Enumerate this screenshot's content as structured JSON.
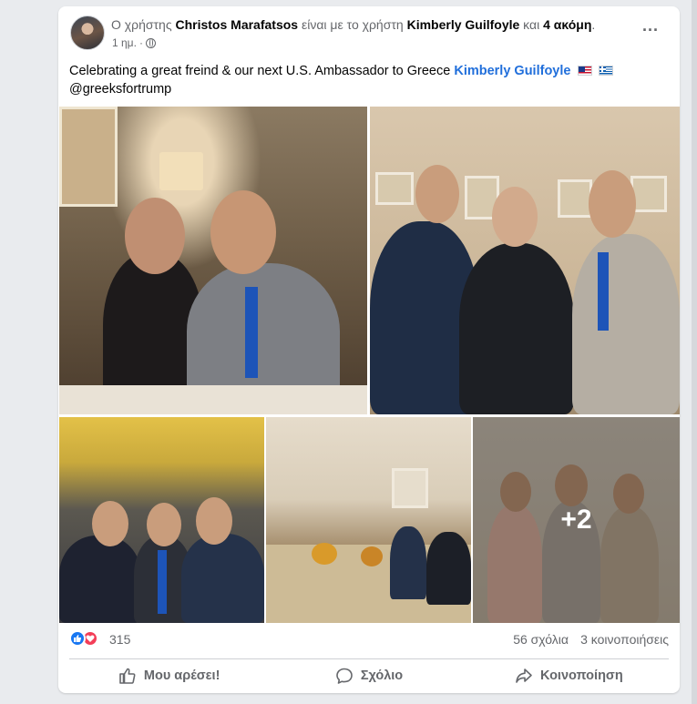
{
  "post": {
    "header": {
      "prefix": "Ο χρήστης",
      "author": "Christos Marafatsos",
      "middle": "είναι με το χρήστη",
      "tagged": "Kimberly Guilfoyle",
      "joiner": "και",
      "others": "4 ακόμη",
      "suffix": ".",
      "time": "1 ημ.",
      "separator": "·",
      "audience_icon": "globe-icon",
      "more_label": "..."
    },
    "text": {
      "body": "Celebrating a great freind & our next U.S. Ambassador to Greece",
      "mention": "Kimberly Guilfoyle",
      "flag1": "us-flag-icon",
      "flag2": "greece-flag-icon",
      "hashtag": "@greeksfortrump"
    },
    "photos": {
      "more_count": "+2"
    },
    "stats": {
      "reactions": "315",
      "comments": "56 σχόλια",
      "shares": "3 κοινοποιήσεις",
      "reaction_icons": [
        "like-icon",
        "love-icon"
      ]
    },
    "actions": {
      "like": "Μου αρέσει!",
      "comment": "Σχόλιο",
      "share": "Κοινοποίηση"
    },
    "colors": {
      "link": "#216fdb",
      "like_blue": "#1877f2",
      "love_red": "#f33e58",
      "muted": "#65676b"
    }
  }
}
